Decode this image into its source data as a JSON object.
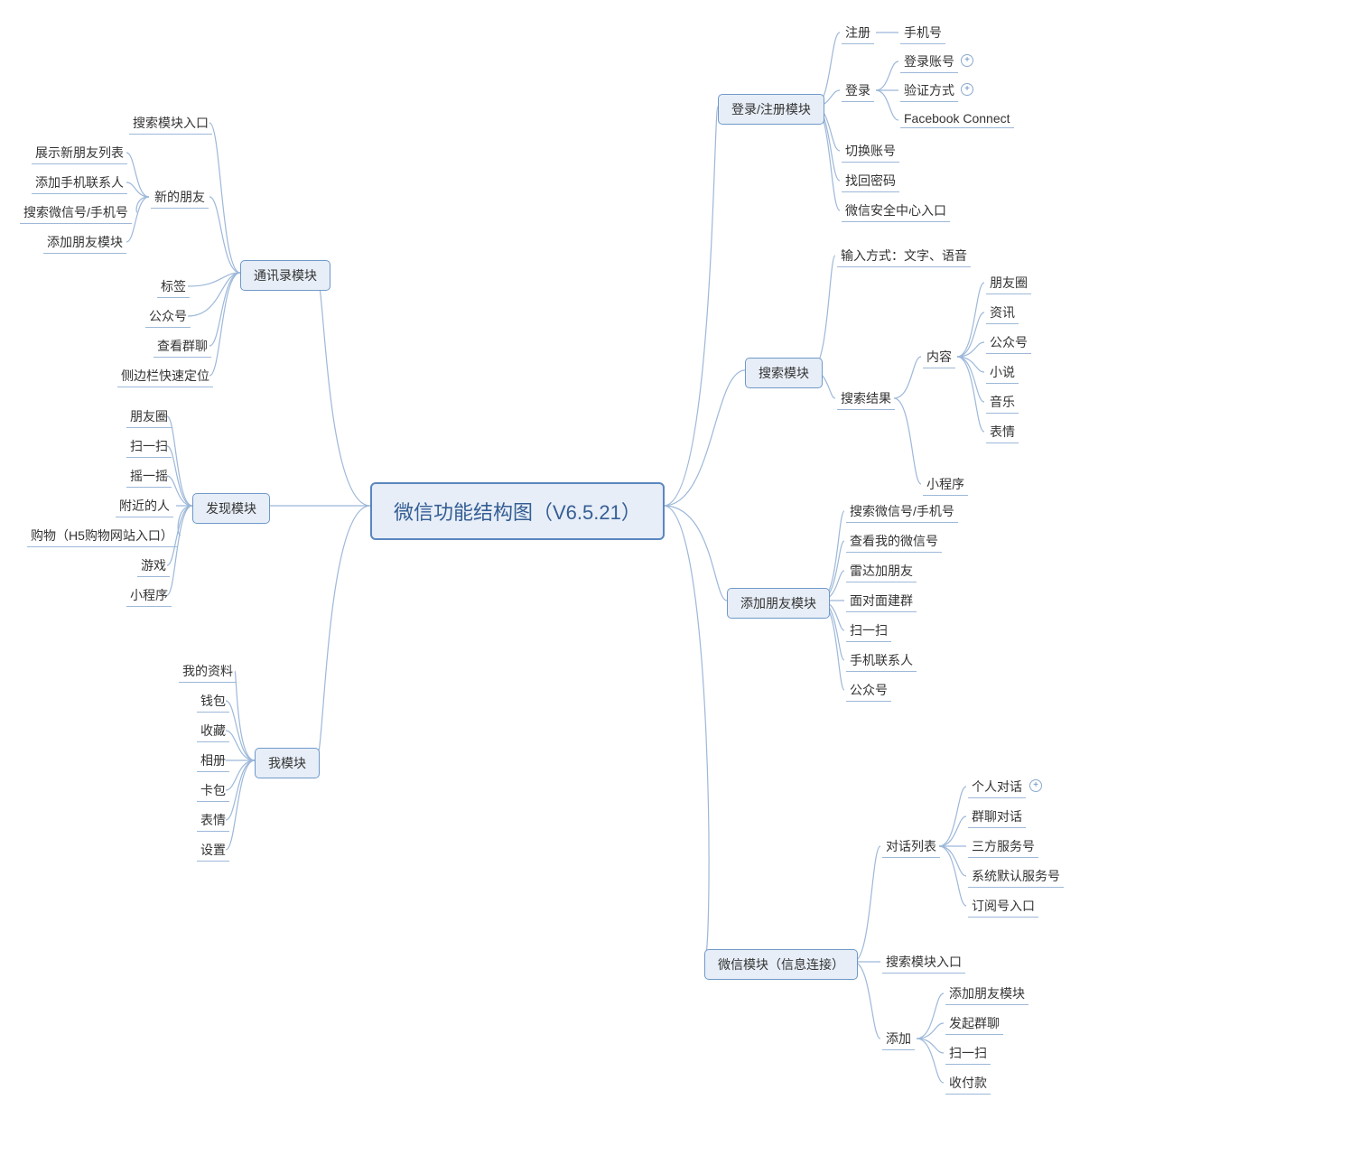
{
  "root": {
    "label": "微信功能结构图（V6.5.21）"
  },
  "left": {
    "contacts": {
      "label": "通讯录模块",
      "children": {
        "search_entry": "搜索模块入口",
        "new_friends": {
          "label": "新的朋友",
          "children": {
            "show_list": "展示新朋友列表",
            "add_phone": "添加手机联系人",
            "search_id": "搜索微信号/手机号",
            "add_module": "添加朋友模块"
          }
        },
        "tags": "标签",
        "official": "公众号",
        "view_groups": "查看群聊",
        "sidebar_locate": "侧边栏快速定位"
      }
    },
    "discover": {
      "label": "发现模块",
      "children": {
        "moments": "朋友圈",
        "scan": "扫一扫",
        "shake": "摇一摇",
        "nearby": "附近的人",
        "shop": "购物（H5购物网站入口）",
        "games": "游戏",
        "mini": "小程序"
      }
    },
    "me": {
      "label": "我模块",
      "children": {
        "profile": "我的资料",
        "wallet": "钱包",
        "favorites": "收藏",
        "album": "相册",
        "cards": "卡包",
        "sticker": "表情",
        "settings": "设置"
      }
    }
  },
  "right": {
    "auth": {
      "label": "登录/注册模块",
      "children": {
        "register": {
          "label": "注册",
          "children": {
            "phone": "手机号"
          }
        },
        "login": {
          "label": "登录",
          "children": {
            "account": "登录账号",
            "verify": "验证方式",
            "fb": "Facebook Connect"
          }
        },
        "switch": "切换账号",
        "forgot": "找回密码",
        "security": "微信安全中心入口"
      }
    },
    "search": {
      "label": "搜索模块",
      "children": {
        "input": "输入方式：文字、语音",
        "result": {
          "label": "搜索结果",
          "children": {
            "content": {
              "label": "内容",
              "children": {
                "moments": "朋友圈",
                "news": "资讯",
                "official": "公众号",
                "novel": "小说",
                "music": "音乐",
                "sticker": "表情"
              }
            },
            "mini": "小程序"
          }
        }
      }
    },
    "addfriend": {
      "label": "添加朋友模块",
      "children": {
        "search_id": "搜索微信号/手机号",
        "my_id": "查看我的微信号",
        "radar": "雷达加朋友",
        "f2f": "面对面建群",
        "scan": "扫一扫",
        "phone_contacts": "手机联系人",
        "official": "公众号"
      }
    },
    "wechat": {
      "label": "微信模块（信息连接）",
      "children": {
        "chatlist": {
          "label": "对话列表",
          "children": {
            "personal": "个人对话",
            "group": "群聊对话",
            "thirdparty": "三方服务号",
            "system": "系统默认服务号",
            "subscribe": "订阅号入口"
          }
        },
        "search_entry": "搜索模块入口",
        "add": {
          "label": "添加",
          "children": {
            "addfriend": "添加朋友模块",
            "groupchat": "发起群聊",
            "scan": "扫一扫",
            "pay": "收付款"
          }
        }
      }
    }
  }
}
